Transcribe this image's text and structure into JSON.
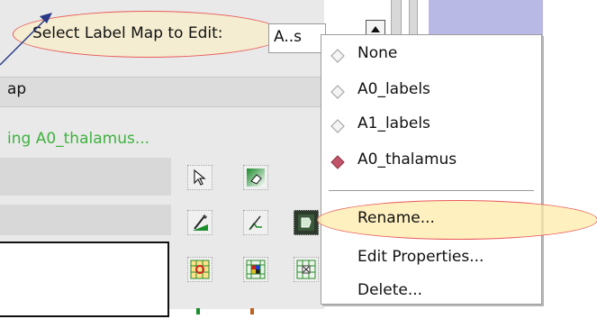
{
  "selector": {
    "label": "Select Label Map to Edit:",
    "selected": "A..s"
  },
  "panel": {
    "header": "ap",
    "status": "ing A0_thalamus..."
  },
  "menu": {
    "options": [
      {
        "label": "None",
        "selected": false
      },
      {
        "label": "A0_labels",
        "selected": false
      },
      {
        "label": "A1_labels",
        "selected": false
      },
      {
        "label": "A0_thalamus",
        "selected": true
      }
    ],
    "actions": [
      {
        "label": "Rename..."
      },
      {
        "label": "Edit Properties..."
      },
      {
        "label": "Delete..."
      }
    ]
  },
  "colors": {
    "highlight_outline": "#e85a5a",
    "highlight_fill": "#ffecaa",
    "status_green": "#3fb23f",
    "selected_diamond": "#c0556a",
    "accent_panel": "#b9b9e6"
  },
  "icons": [
    "select-arrow-icon",
    "eraser-icon",
    "paint-brush-icon",
    "draw-line-icon",
    "level-tracing-icon",
    "grid-target-icon",
    "grid-color-icon",
    "grid-delete-icon"
  ]
}
